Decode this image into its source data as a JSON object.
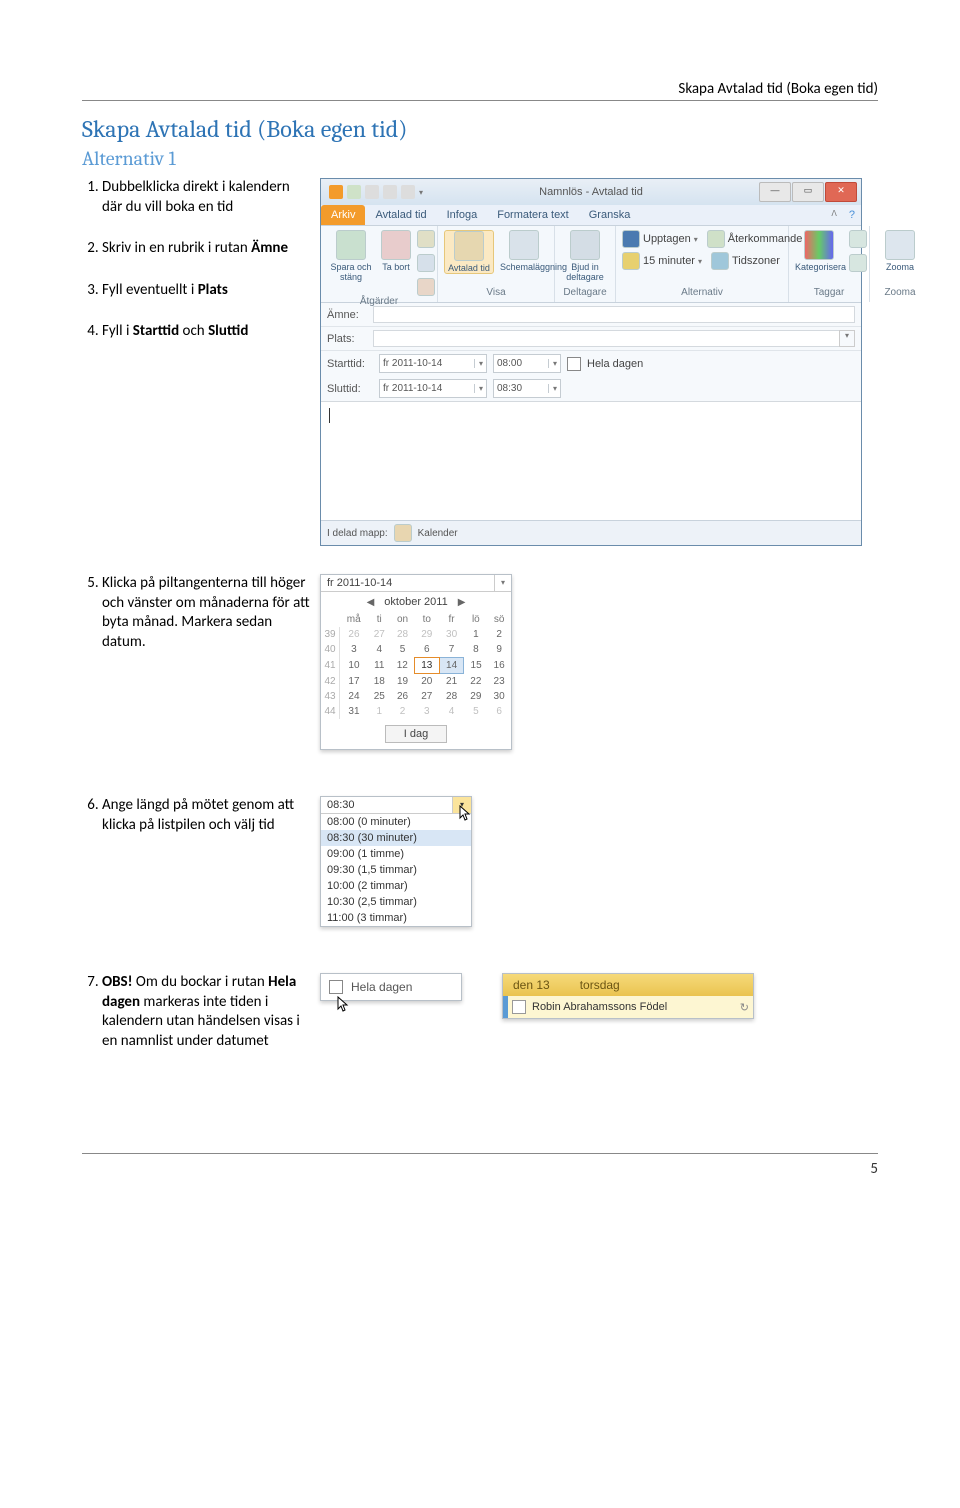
{
  "header_title": "Skapa Avtalad tid (Boka egen tid)",
  "doc_title": "Skapa Avtalad tid (Boka egen tid)",
  "doc_sub": "Alternativ 1",
  "steps": {
    "s1": "Dubbelklicka direkt i kalendern där du vill boka en tid",
    "s2": "Skriv in en rubrik i rutan ",
    "s2b": "Ämne",
    "s3a": "Fyll eventuellt i ",
    "s3b": "Plats",
    "s4a": "Fyll i ",
    "s4b": "Starttid",
    "s4c": " och ",
    "s4d": "Sluttid",
    "s5": "Klicka på piltangenterna till höger och vänster om månaderna för att byta månad. Markera sedan datum.",
    "s6": "Ange längd på mötet genom att klicka på listpilen och välj tid",
    "s7b": "OBS!",
    "s7a": " Om du bockar i rutan ",
    "s7c": "Hela dagen",
    "s7d": " markeras inte tiden i kalendern utan händelsen visas i en namnlist under datumet"
  },
  "window": {
    "title": "Namnlös  -  Avtalad tid",
    "tabs": [
      "Arkiv",
      "Avtalad tid",
      "Infoga",
      "Formatera text",
      "Granska"
    ],
    "groups": {
      "g1": {
        "label": "Åtgärder",
        "b1": "Spara och stäng",
        "b2": "Ta bort"
      },
      "g2": {
        "label": "Visa",
        "b1": "Avtalad tid",
        "b2": "Schemaläggning"
      },
      "g3": {
        "label": "Deltagare",
        "b1": "Bjud in deltagare"
      },
      "g4": {
        "label": "Alternativ",
        "l1": "Upptagen",
        "l2": "15 minuter",
        "b1": "Återkommande",
        "b2": "Tidszoner"
      },
      "g5": {
        "label": "Taggar",
        "b1": "Kategorisera"
      },
      "g6": {
        "label": "Zooma",
        "b1": "Zooma"
      }
    },
    "labels": {
      "amne": "Ämne:",
      "plats": "Plats:",
      "start": "Starttid:",
      "slut": "Sluttid:"
    },
    "startdate": "fr 2011-10-14",
    "starttime": "08:00",
    "enddate": "fr 2011-10-14",
    "endtime": "08:30",
    "heladagen": "Hela dagen",
    "statusbar": {
      "a": "I delad mapp:",
      "b": "Kalender"
    }
  },
  "datepicker": {
    "field": "fr 2011-10-14",
    "month": "oktober 2011",
    "dow": [
      "må",
      "ti",
      "on",
      "to",
      "fr",
      "lö",
      "sö"
    ],
    "weeks": [
      {
        "wk": "39",
        "d": [
          "26",
          "27",
          "28",
          "29",
          "30",
          "1",
          "2"
        ],
        "out": [
          0,
          1,
          2,
          3,
          4
        ]
      },
      {
        "wk": "40",
        "d": [
          "3",
          "4",
          "5",
          "6",
          "7",
          "8",
          "9"
        ],
        "out": []
      },
      {
        "wk": "41",
        "d": [
          "10",
          "11",
          "12",
          "13",
          "14",
          "15",
          "16"
        ],
        "out": [],
        "today": 3,
        "sel": 4
      },
      {
        "wk": "42",
        "d": [
          "17",
          "18",
          "19",
          "20",
          "21",
          "22",
          "23"
        ],
        "out": []
      },
      {
        "wk": "43",
        "d": [
          "24",
          "25",
          "26",
          "27",
          "28",
          "29",
          "30"
        ],
        "out": []
      },
      {
        "wk": "44",
        "d": [
          "31",
          "1",
          "2",
          "3",
          "4",
          "5",
          "6"
        ],
        "out": [
          1,
          2,
          3,
          4,
          5,
          6
        ]
      }
    ],
    "today_btn": "I dag"
  },
  "timelist": {
    "field": "08:30",
    "items": [
      "08:00 (0 minuter)",
      "08:30 (30 minuter)",
      "09:00 (1 timme)",
      "09:30 (1,5 timmar)",
      "10:00 (2 timmar)",
      "10:30 (2,5 timmar)",
      "11:00 (3 timmar)"
    ],
    "sel_index": 1
  },
  "hela_sample": "Hela dagen",
  "cal_sample": {
    "daynum": "den 13",
    "dayname": "torsdag",
    "event": "Robin Abrahamssons Födel"
  },
  "page_number": "5"
}
